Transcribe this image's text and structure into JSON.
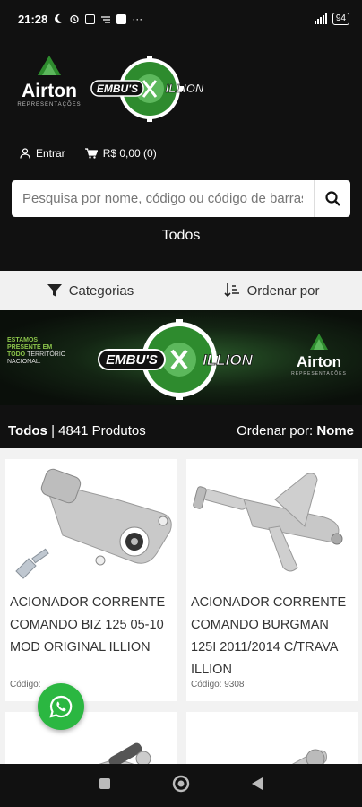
{
  "status_bar": {
    "time": "21:28",
    "battery": "94"
  },
  "header": {
    "logo_airton_text": "Airton",
    "logo_airton_sub": "REPRESENTAÇÕES",
    "logo_embus_text_left": "EMBU'S",
    "logo_embus_text_right": "ILLION",
    "login_label": "Entrar",
    "cart_label": "R$ 0,00 (0)",
    "search_placeholder": "Pesquisa por nome, código ou código de barras",
    "all_link": "Todos"
  },
  "filters": {
    "categories_label": "Categorias",
    "sort_label": "Ordenar por"
  },
  "banner": {
    "slogan_line1": "ESTAMOS",
    "slogan_line2": "PRESENTE EM",
    "slogan_line3": "TODO",
    "slogan_line3b": "TERRITÓRIO",
    "slogan_line4": "NACIONAL."
  },
  "list_header": {
    "category": "Todos",
    "count": "| 4841 Produtos",
    "sort_prefix": "Ordenar por:",
    "sort_value": "Nome"
  },
  "products": [
    {
      "name": "ACIONADOR CORRENTE COMANDO BIZ 125 05-10 MOD ORIGINAL ILLION",
      "code": "Código:"
    },
    {
      "name": "ACIONADOR CORRENTE COMANDO BURGMAN 125i 2011/2014 C/TRAVA ILLION",
      "code": "Código: 9308"
    }
  ],
  "colors": {
    "brand_green": "#2e8b2e",
    "whatsapp": "#2bb741",
    "header_bg": "#111111"
  }
}
